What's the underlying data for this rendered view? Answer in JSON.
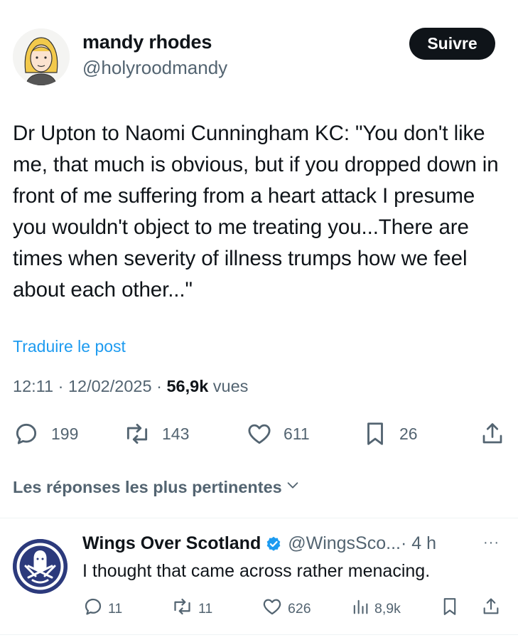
{
  "author": {
    "name": "mandy rhodes",
    "handle": "@holyroodmandy",
    "follow_label": "Suivre"
  },
  "tweet": {
    "text": "Dr Upton to Naomi Cunningham KC: \"You don't like me, that much is obvious, but if you dropped down in front of me suffering from a heart attack I presume you wouldn't object to me treating you...There are times when severity of illness trumps how we feel about each other...\"",
    "translate_label": "Traduire le post",
    "time": "12:11 · 12/02/2025 · ",
    "views_count": "56,9k",
    "views_label": " vues"
  },
  "actions": {
    "replies": "199",
    "reposts": "143",
    "likes": "611",
    "bookmarks": "26"
  },
  "replies_sort": {
    "label": "Les réponses les plus pertinentes"
  },
  "reply": {
    "name": "Wings Over Scotland",
    "handle": "@WingsSco...",
    "time": " · 4 h",
    "more": "···",
    "text": "I thought that came across rather menacing.",
    "replies": "11",
    "reposts": "11",
    "likes": "626",
    "views": "8,9k"
  },
  "colors": {
    "accent": "#1d9bf0",
    "secondary_text": "#536471",
    "primary_text": "#0f1419",
    "verified": "#1d9bf0"
  }
}
